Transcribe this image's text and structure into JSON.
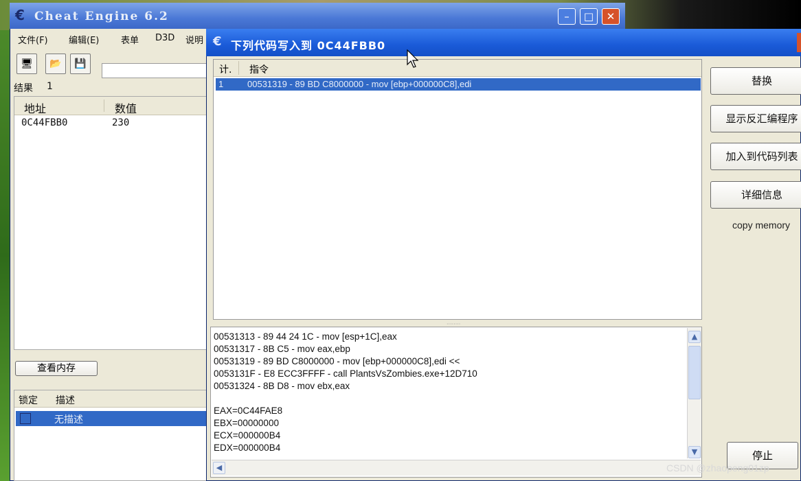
{
  "main_window": {
    "title": "Cheat Engine 6.2",
    "menu": [
      "文件(F)",
      "编辑(E)",
      "表单",
      "D3D",
      "说明"
    ],
    "results_label": "结果",
    "results_count": "1",
    "address_list": {
      "columns": [
        "地址",
        "数值"
      ],
      "rows": [
        {
          "address": "0C44FBB0",
          "value": "230"
        }
      ]
    },
    "view_memory_button": "查看内存",
    "cheat_table": {
      "columns": [
        "锁定",
        "描述"
      ],
      "rows": [
        {
          "description": "无描述"
        }
      ]
    }
  },
  "dialog": {
    "title": "下列代码写入到  0C44FBB0",
    "list_columns": [
      "计.",
      "指令"
    ],
    "rows": [
      {
        "count": "1",
        "instruction": "00531319 - 89 BD C8000000  - mov [ebp+000000C8],edi"
      }
    ],
    "disassembly": [
      "00531313 - 89 44 24 1C  - mov [esp+1C],eax",
      "00531317 - 8B C5  - mov eax,ebp",
      "00531319 - 89 BD C8000000  - mov [ebp+000000C8],edi <<",
      "0053131F - E8 ECC3FFFF - call PlantsVsZombies.exe+12D710",
      "00531324 - 8B D8  - mov ebx,eax",
      "",
      "EAX=0C44FAE8",
      "EBX=00000000",
      "ECX=000000B4",
      "EDX=000000B4"
    ],
    "buttons": {
      "replace": "替换",
      "show_disassembler": "显示反汇编程序",
      "add_to_codelist": "加入到代码列表",
      "more_info": "详细信息",
      "stop": "停止"
    },
    "note": "copy memory"
  },
  "watermark": "CSDN @zhaopeng01zp"
}
